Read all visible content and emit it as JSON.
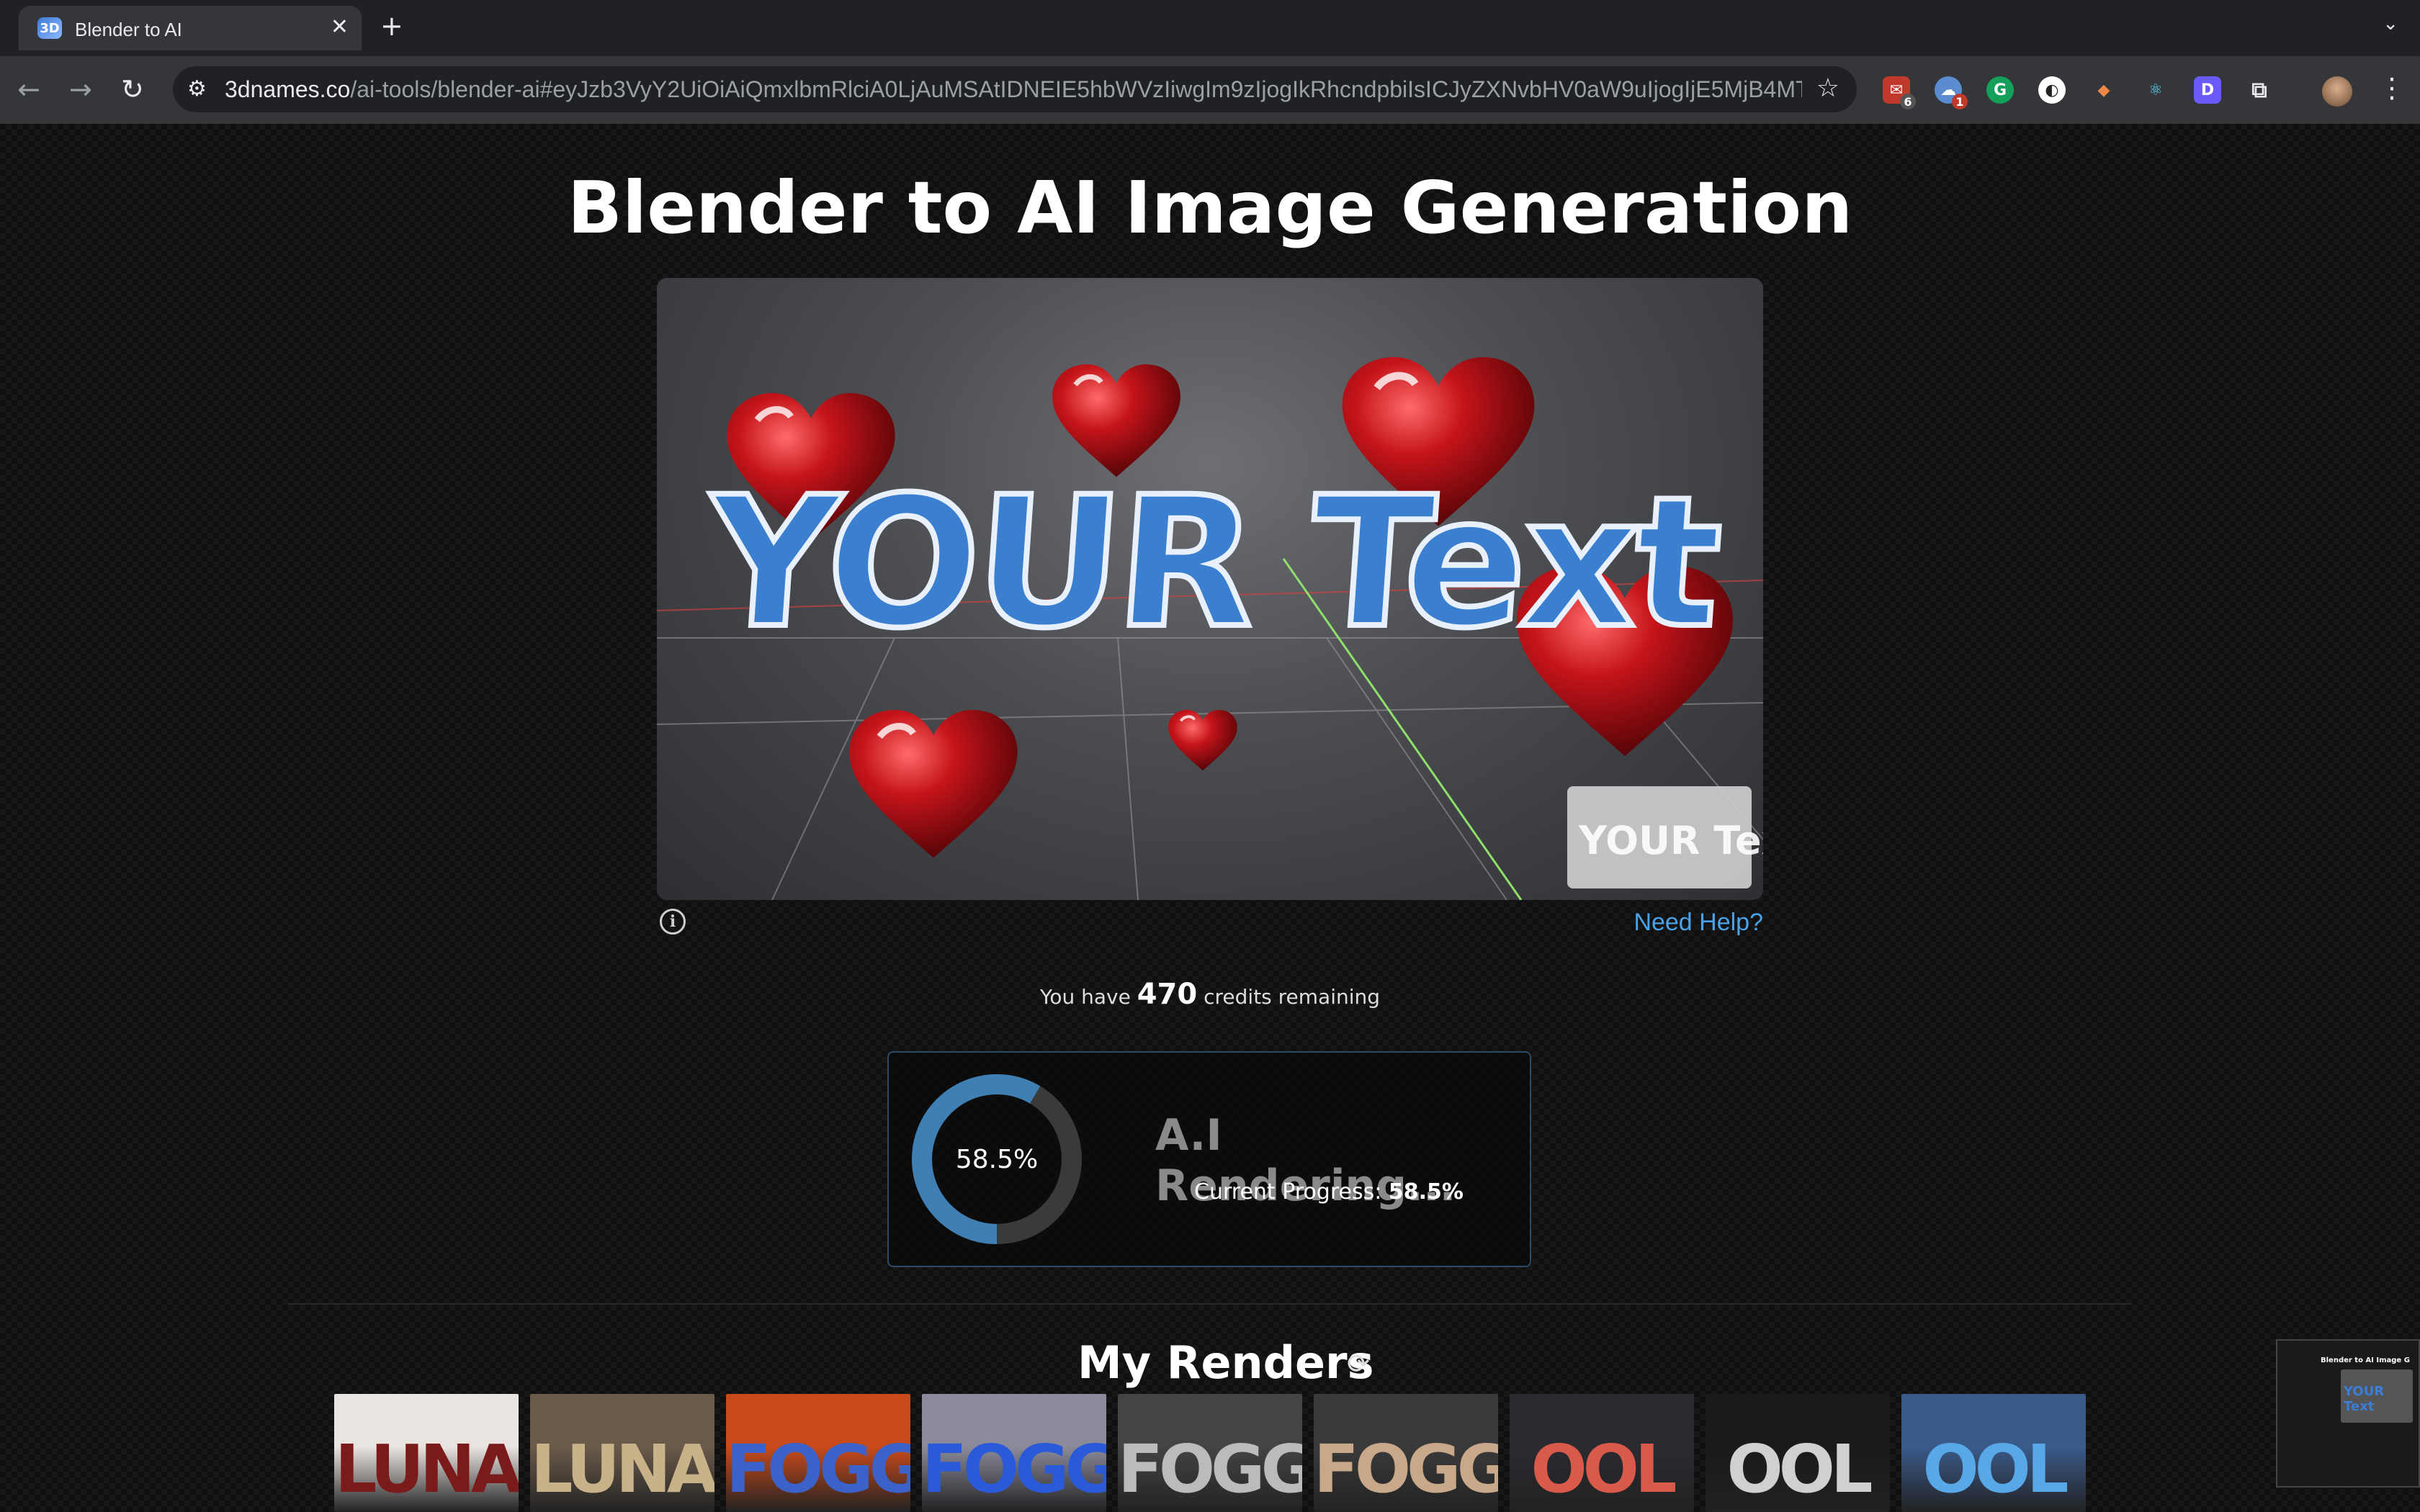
{
  "browser": {
    "tab_title": "Blender to AI",
    "tab_favicon": "3D",
    "url_host": "3dnames.co",
    "url_path": "/ai-tools/blender-ai#eyJzb3VyY2UiOiAiQmxlbmRlciA0LjAuMSAtIDNEIE5hbWVzIiwgIm9zIjogIkRhcndpbiIsICJyZXNvbHV0aW9uIjogIjE5MjB4MTA4MCIsIC...",
    "extension_badges": {
      "ext1": "6",
      "ext2": "1"
    }
  },
  "page": {
    "title": "Blender to AI Image Generation",
    "preview_text": "YOUR Text",
    "help_link": "Need Help?",
    "credits_prefix": "You have",
    "credits_value": "470",
    "credits_suffix": "credits remaining"
  },
  "progress": {
    "percent_label": "58.5%",
    "percent_value": 58.5,
    "status_title": "A.I Rendering...",
    "current_label": "Current Progress:",
    "current_value": "58.5%"
  },
  "renders": {
    "heading": "My Renders",
    "thumbnails": [
      {
        "text": "LUNA",
        "colors": [
          "#e9e4e0",
          "#7a1a1a"
        ]
      },
      {
        "text": "LUNA",
        "colors": [
          "#6a5a4a",
          "#c8b28a"
        ]
      },
      {
        "text": "FOGG",
        "colors": [
          "#c84a1a",
          "#3a62c8"
        ]
      },
      {
        "text": "FOGG",
        "colors": [
          "#8a8a9a",
          "#2a5ad8"
        ]
      },
      {
        "text": "FOGG",
        "colors": [
          "#444",
          "#bbb"
        ]
      },
      {
        "text": "FOGG",
        "colors": [
          "#3a3a3a",
          "#c8a888"
        ]
      },
      {
        "text": "OOL",
        "colors": [
          "#2a2a30",
          "#d85a4a"
        ]
      },
      {
        "text": "OOL",
        "colors": [
          "#1a1a1a",
          "#d0d0d0"
        ]
      },
      {
        "text": "OOL",
        "colors": [
          "#3a5a8a",
          "#58a8e8"
        ]
      }
    ]
  },
  "mini_window": {
    "title": "Blender to AI Image G"
  },
  "colors": {
    "accent": "#4aa3e8",
    "ring": "#3f7fb3",
    "ring_track": "#3a3a3a"
  }
}
